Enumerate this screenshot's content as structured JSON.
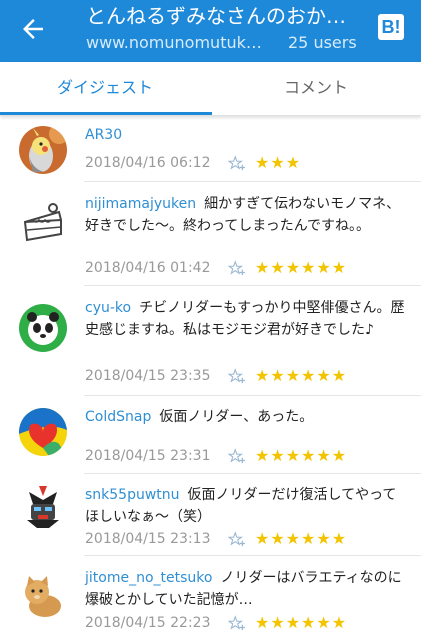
{
  "header": {
    "title": "とんねるずみなさんのおか…",
    "url": "www.nomunomutuk…",
    "users": "25 users",
    "hatena_badge": "B!"
  },
  "tabs": [
    {
      "label": "ダイジェスト",
      "active": true
    },
    {
      "label": "コメント",
      "active": false
    }
  ],
  "colors": {
    "accent": "#1e88d9",
    "user": "#2f8fd4",
    "star": "#f3c400"
  },
  "comments": [
    {
      "user": "AR30",
      "text": "",
      "date": "2018/04/16 06:12",
      "stars": "★★★",
      "star_count": 3
    },
    {
      "user": "nijimamajyuken",
      "text": "細かすぎて伝わないモノマネ、好きでした〜。終わってしまったんですね。。",
      "date": "2018/04/16 01:42",
      "stars": "★★★★★★",
      "star_count": 6
    },
    {
      "user": "cyu-ko",
      "text": "チビノリダーもすっかり中堅俳優さん。歴史感じますね。私はモジモジ君が好きでした♪",
      "date": "2018/04/15 23:35",
      "stars": "★★★★★★",
      "star_count": 6
    },
    {
      "user": "ColdSnap",
      "text": "仮面ノリダー、あった。",
      "date": "2018/04/15 23:31",
      "stars": "★★★★★★",
      "star_count": 6
    },
    {
      "user": "snk55puwtnu",
      "text": "仮面ノリダーだけ復活してやってほしいなぁ〜（笑）",
      "date": "2018/04/15 23:13",
      "stars": "★★★★★★",
      "star_count": 6
    },
    {
      "user": "jitome_no_tetsuko",
      "text": "ノリダーはバラエティなのに爆破とかしていた記憶が…",
      "date": "2018/04/15 22:23",
      "stars": "★★★★★★",
      "star_count": 6
    }
  ]
}
